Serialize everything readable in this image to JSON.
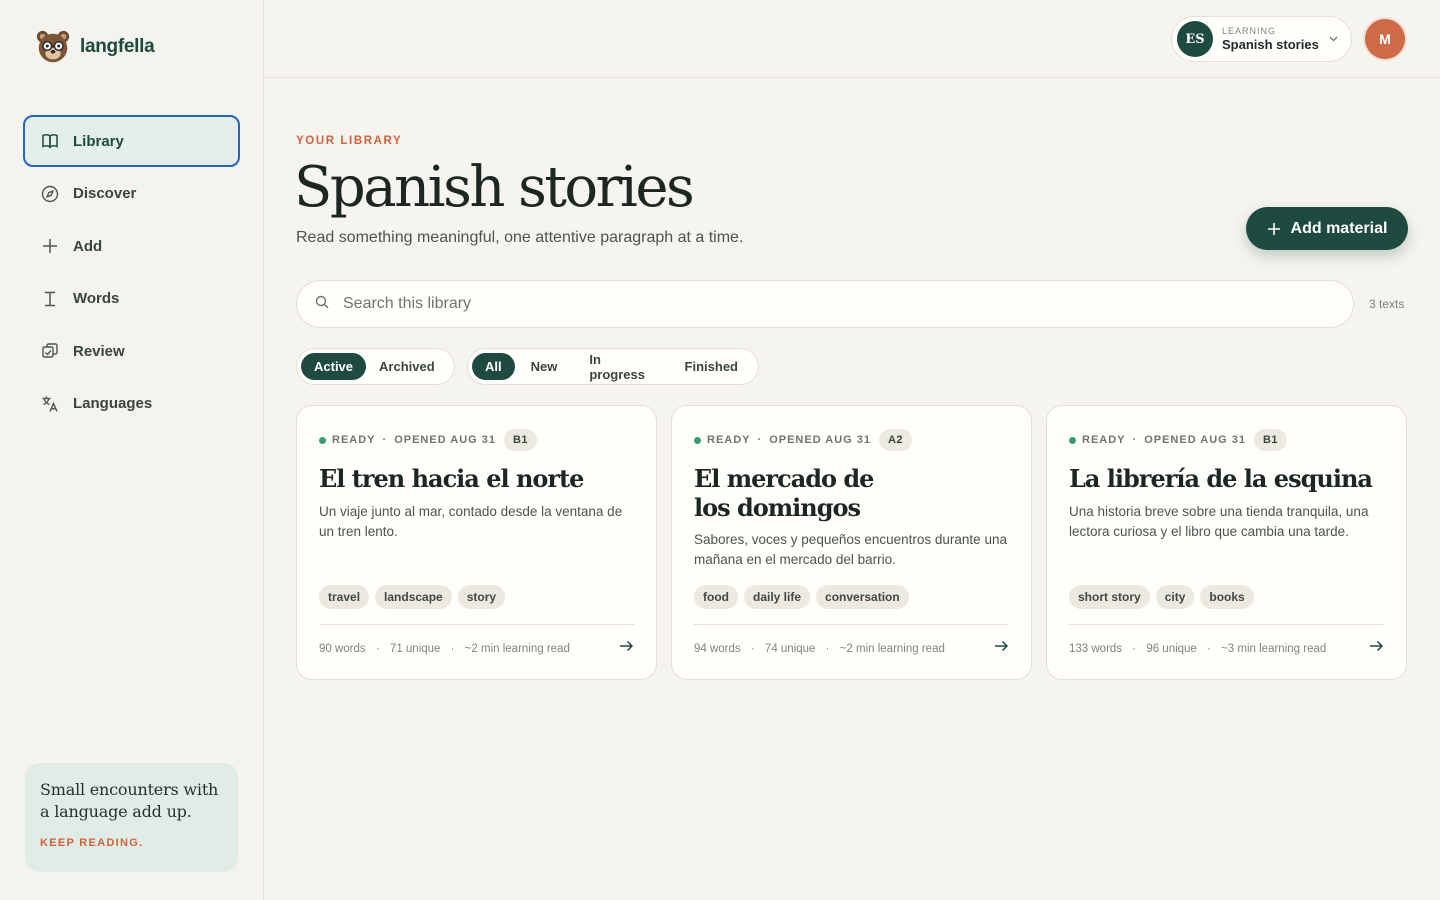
{
  "brand": {
    "name": "langfella"
  },
  "sidebar": {
    "items": [
      {
        "label": "Library",
        "icon": "book-icon",
        "active": true
      },
      {
        "label": "Discover",
        "icon": "compass-icon",
        "active": false
      },
      {
        "label": "Add",
        "icon": "plus-icon",
        "active": false
      },
      {
        "label": "Words",
        "icon": "text-cursor-icon",
        "active": false
      },
      {
        "label": "Review",
        "icon": "cards-icon",
        "active": false
      },
      {
        "label": "Languages",
        "icon": "translate-icon",
        "active": false
      }
    ],
    "quote": {
      "text": "Small encounters with a language add up.",
      "cta": "KEEP READING."
    }
  },
  "topbar": {
    "language": {
      "code": "ES",
      "caption": "LEARNING",
      "name": "Spanish stories"
    },
    "avatar_initial": "M"
  },
  "header": {
    "eyebrow": "YOUR LIBRARY",
    "title": "Spanish stories",
    "subtitle": "Read something meaningful, one attentive paragraph at a time.",
    "add_button": "Add material"
  },
  "search": {
    "placeholder": "Search this library",
    "count": "3 texts"
  },
  "filters": {
    "status": [
      {
        "label": "Active",
        "selected": true
      },
      {
        "label": "Archived",
        "selected": false
      }
    ],
    "progress": [
      {
        "label": "All",
        "selected": true
      },
      {
        "label": "New",
        "selected": false
      },
      {
        "label": "In progress",
        "selected": false
      },
      {
        "label": "Finished",
        "selected": false
      }
    ]
  },
  "cards": [
    {
      "status": "READY",
      "opened": "OPENED AUG 31",
      "level": "B1",
      "title": "El tren hacia el norte",
      "description": "Un viaje junto al mar, contado desde la ventana de un tren lento.",
      "tags": [
        "travel",
        "landscape",
        "story"
      ],
      "words": "90 words",
      "unique": "71 unique",
      "read_time": "~2 min learning read"
    },
    {
      "status": "READY",
      "opened": "OPENED AUG 31",
      "level": "A2",
      "title": "El mercado de los domingos",
      "description": "Sabores, voces y pequeños encuentros durante una mañana en el mercado del barrio.",
      "tags": [
        "food",
        "daily life",
        "conversation"
      ],
      "words": "94 words",
      "unique": "74 unique",
      "read_time": "~2 min learning read"
    },
    {
      "status": "READY",
      "opened": "OPENED AUG 31",
      "level": "B1",
      "title": "La librería de la esquina",
      "description": "Una historia breve sobre una tienda tranquila, una lectora curiosa y el libro que cambia una tarde.",
      "tags": [
        "short story",
        "city",
        "books"
      ],
      "words": "133 words",
      "unique": "96 unique",
      "read_time": "~3 min learning read"
    }
  ],
  "colors": {
    "brand_green": "#1e4a3f",
    "accent_orange": "#d2623a",
    "ready_green": "#3a9b6e"
  }
}
